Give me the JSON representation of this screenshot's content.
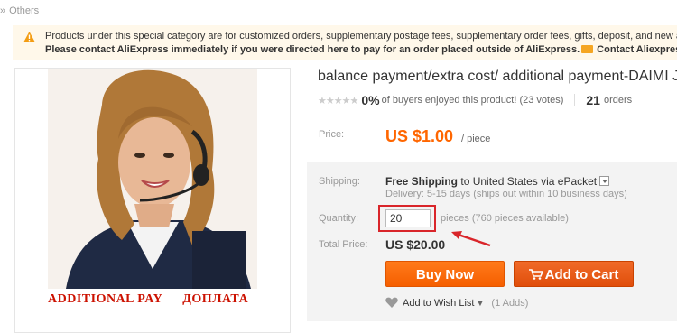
{
  "breadcrumb": {
    "separator": "»",
    "current": "Others"
  },
  "notice": {
    "icon": "warning-icon",
    "line1": "Products under this special category are for customized orders, supplementary postage fees, supplementary order fees, gifts, deposit, and new arrival",
    "line2": "Please contact AliExpress immediately if you were directed here to pay for an order placed outside of AliExpress.",
    "contact_link": "Contact Aliexpress"
  },
  "product": {
    "image_caption_en": "ADDITIONAL PAY",
    "image_caption_ru": "ДОПЛАТА",
    "title": "balance payment/extra cost/ additional payment-DAIMI Je",
    "rating_percent": "0%",
    "rating_text": "of buyers enjoyed this product! (23 votes)",
    "stars": 0,
    "orders_count": "21",
    "orders_label": "orders"
  },
  "price": {
    "label": "Price:",
    "value": "US $1.00",
    "unit": "/ piece"
  },
  "shipping": {
    "label": "Shipping:",
    "free": "Free Shipping",
    "to": "to",
    "destination": "United States via ePacket",
    "delivery": "Delivery: 5-15 days (ships out within 10 business days)"
  },
  "quantity": {
    "label": "Quantity:",
    "value": "20",
    "available": "pieces (760 pieces available)"
  },
  "total": {
    "label": "Total Price:",
    "value": "US $20.00"
  },
  "buttons": {
    "buy_now": "Buy Now",
    "add_to_cart": "Add to Cart"
  },
  "wishlist": {
    "label": "Add to Wish List",
    "count": "(1 Adds)"
  },
  "colors": {
    "accent": "#ff6600",
    "annotation_red": "#d9252a",
    "caption_red": "#cc1100",
    "notice_bg": "#fff8ea"
  }
}
